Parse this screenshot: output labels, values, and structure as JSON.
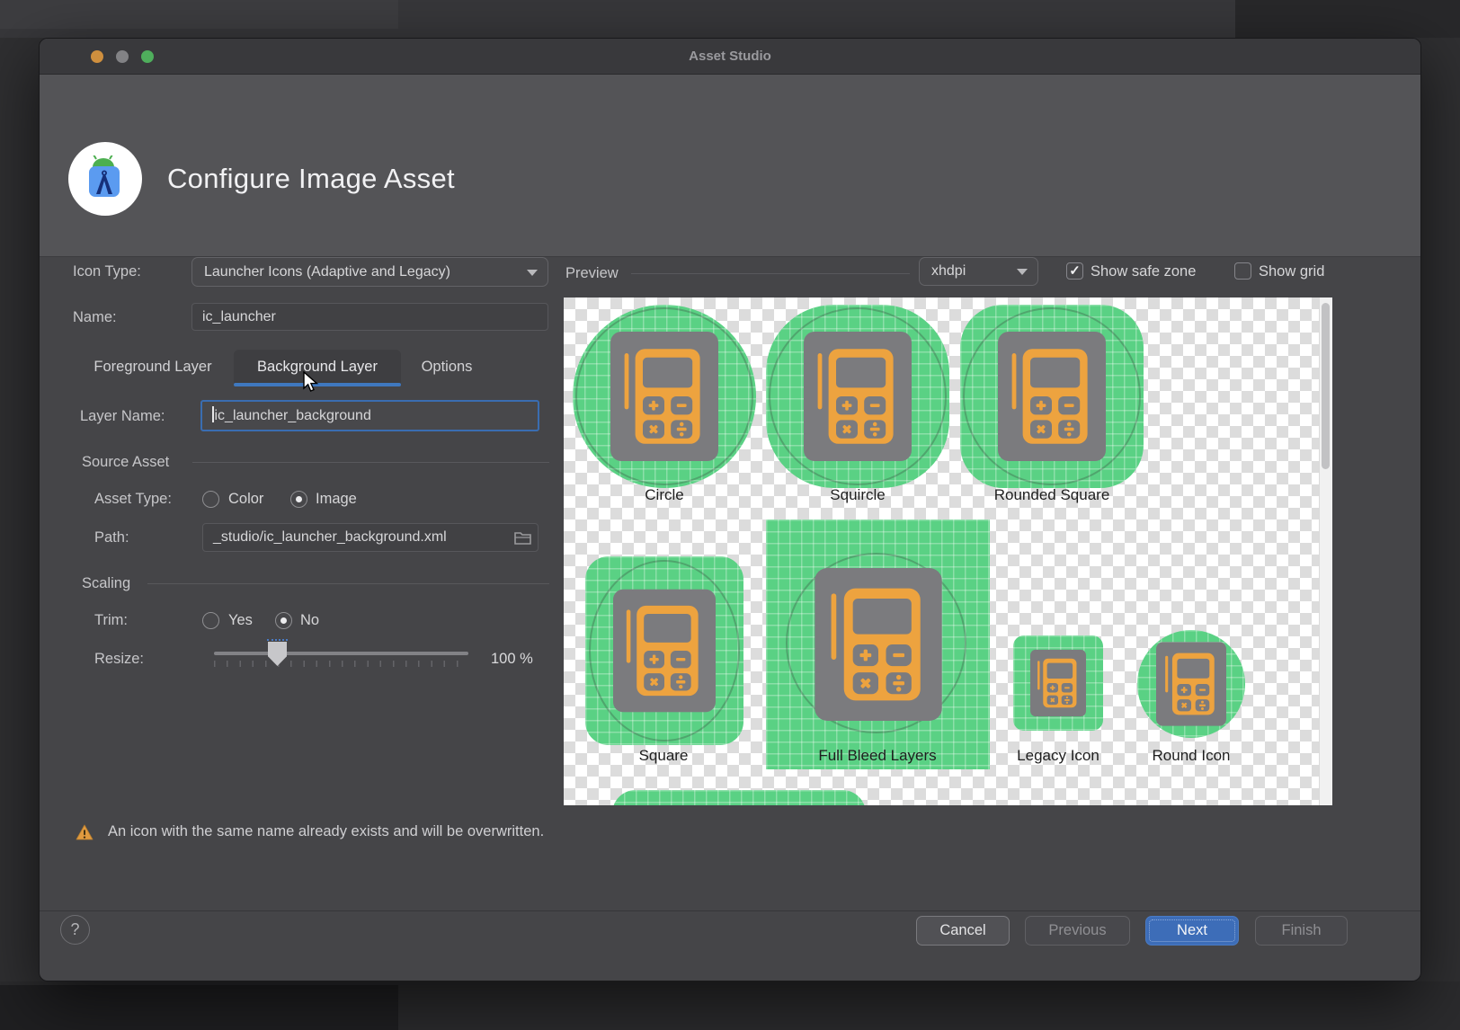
{
  "window": {
    "title": "Asset Studio"
  },
  "header": {
    "dialog_title": "Configure Image Asset"
  },
  "form": {
    "icon_type_label": "Icon Type:",
    "icon_type_value": "Launcher Icons (Adaptive and Legacy)",
    "name_label": "Name:",
    "name_value": "ic_launcher",
    "tabs": [
      {
        "label": "Foreground Layer",
        "selected": false
      },
      {
        "label": "Background Layer",
        "selected": true
      },
      {
        "label": "Options",
        "selected": false
      }
    ],
    "layer_name_label": "Layer Name:",
    "layer_name_value": "ic_launcher_background",
    "source_asset_section": "Source Asset",
    "asset_type_label": "Asset Type:",
    "asset_type_options": [
      {
        "label": "Color",
        "selected": false
      },
      {
        "label": "Image",
        "selected": true
      }
    ],
    "path_label": "Path:",
    "path_value": "_studio/ic_launcher_background.xml",
    "scaling_section": "Scaling",
    "trim_label": "Trim:",
    "trim_options": [
      {
        "label": "Yes",
        "selected": false
      },
      {
        "label": "No",
        "selected": true
      }
    ],
    "resize_label": "Resize:",
    "resize_value": "100 %",
    "resize_percent": 100
  },
  "preview": {
    "section_label": "Preview",
    "density_value": "xhdpi",
    "show_safe_zone": {
      "label": "Show safe zone",
      "checked": true
    },
    "show_grid": {
      "label": "Show grid",
      "checked": false
    },
    "cells": [
      {
        "label": "Circle"
      },
      {
        "label": "Squircle"
      },
      {
        "label": "Rounded Square"
      },
      {
        "label": "Square"
      },
      {
        "label": "Full Bleed Layers"
      },
      {
        "label": "Legacy Icon"
      },
      {
        "label": "Round Icon"
      }
    ]
  },
  "warning": {
    "text": "An icon with the same name already exists and will be overwritten."
  },
  "footer": {
    "help_label": "?",
    "cancel_label": "Cancel",
    "previous_label": "Previous",
    "next_label": "Next",
    "finish_label": "Finish"
  },
  "colors": {
    "accent_blue": "#3d6db8",
    "tab_underline_blue": "#3f78bf",
    "preview_green": "#5ad184",
    "icon_orange": "#eda33f",
    "tile_gray": "#7b7b7e",
    "warning_orange": "#e09a3f"
  }
}
